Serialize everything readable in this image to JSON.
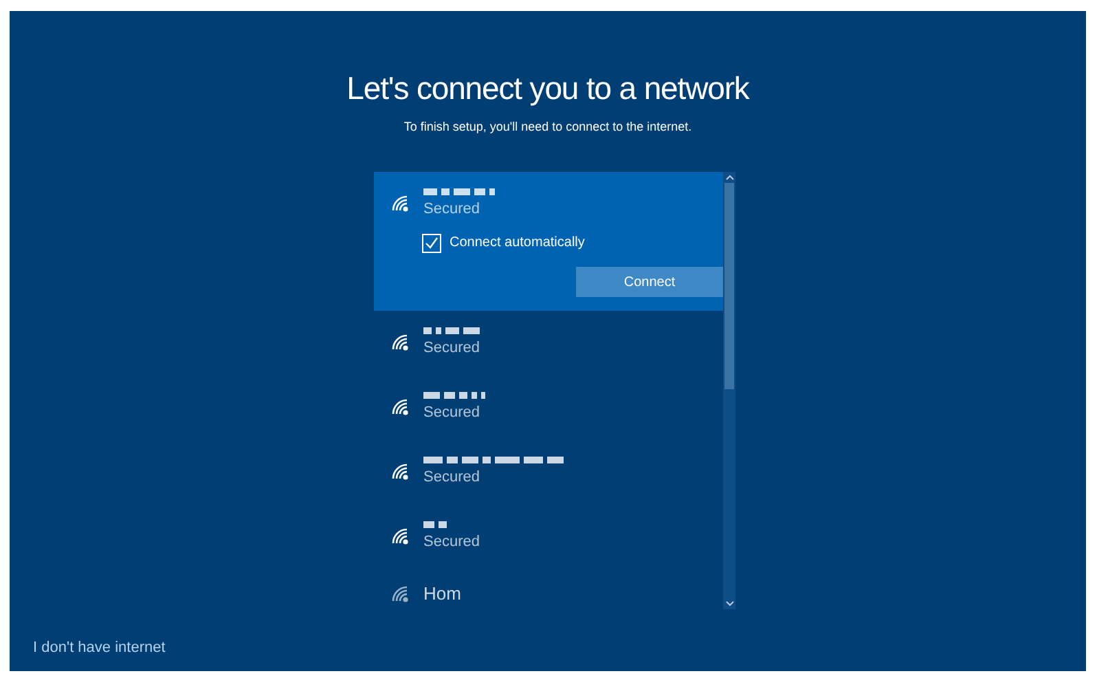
{
  "title": "Let's connect you to a network",
  "subtitle": "To finish setup, you'll need to connect to the internet.",
  "networks": [
    {
      "kind": "redacted",
      "status": "Secured",
      "selected": true
    },
    {
      "kind": "redacted",
      "status": "Secured",
      "selected": false
    },
    {
      "kind": "redacted",
      "status": "Secured",
      "selected": false
    },
    {
      "kind": "redacted",
      "status": "Secured",
      "selected": false
    },
    {
      "kind": "redacted",
      "status": "Secured",
      "selected": false
    },
    {
      "kind": "named",
      "name": "Hom",
      "selected": false
    }
  ],
  "connect_options": {
    "label": "Connect automatically",
    "checked": true,
    "button": "Connect"
  },
  "skip_link": "I don't have internet"
}
